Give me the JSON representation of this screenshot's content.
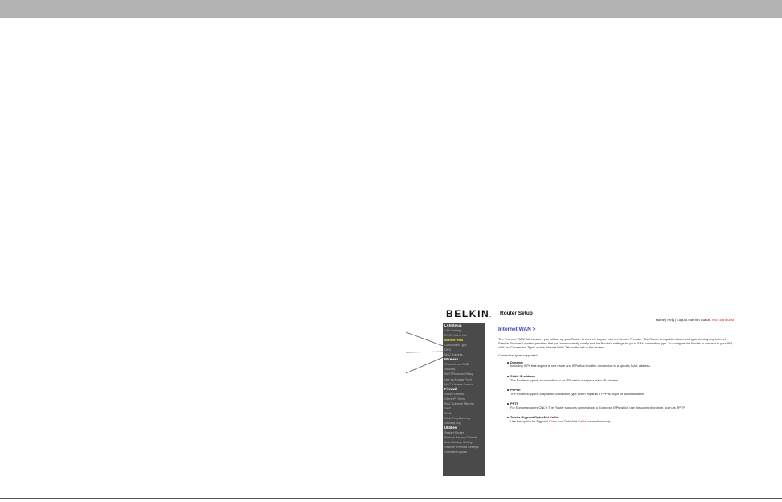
{
  "header": {
    "brand": "BELKIN",
    "title": "Router Setup",
    "links": {
      "home": "Home",
      "help": "Help",
      "logout": "Logout",
      "separator": "|"
    },
    "status_label": "Internet Status:",
    "status_value": "Not connected",
    "colors": {
      "status": "#d41a1a"
    }
  },
  "sidebar": {
    "items": [
      {
        "label": "LAN Setup",
        "type": "section"
      },
      {
        "label": "LAN Settings",
        "type": "item"
      },
      {
        "label": "DHCP Client List",
        "type": "item"
      },
      {
        "label": "Internet WAN",
        "type": "active"
      },
      {
        "label": "Connection Type",
        "type": "item"
      },
      {
        "label": "DNS",
        "type": "item"
      },
      {
        "label": "MAC Address",
        "type": "item"
      },
      {
        "label": "Wireless",
        "type": "section"
      },
      {
        "label": "Channel and SSID",
        "type": "item"
      },
      {
        "label": "Security",
        "type": "item"
      },
      {
        "label": "Wi-Fi Protected Setup",
        "type": "item"
      },
      {
        "label": "Use as Access Point",
        "type": "item"
      },
      {
        "label": "MAC Address Control",
        "type": "item"
      },
      {
        "label": "Firewall",
        "type": "section"
      },
      {
        "label": "Virtual Servers",
        "type": "item"
      },
      {
        "label": "Client IP Filters",
        "type": "item"
      },
      {
        "label": "MAC Address Filtering",
        "type": "item"
      },
      {
        "label": "DMZ",
        "type": "item"
      },
      {
        "label": "WAN",
        "type": "item"
      },
      {
        "label": "WAN Ping Blocking",
        "type": "item"
      },
      {
        "label": "Security Log",
        "type": "item"
      },
      {
        "label": "Utilities",
        "type": "section"
      },
      {
        "label": "Restart Router",
        "type": "item"
      },
      {
        "label": "Restore Factory Defaults",
        "type": "item"
      },
      {
        "label": "Save/Backup Settings",
        "type": "item"
      },
      {
        "label": "Restore Previous Settings",
        "type": "item"
      },
      {
        "label": "Firmware Update",
        "type": "item"
      }
    ],
    "colors": {
      "background": "#4a4a4a",
      "section": "#ffffff",
      "item": "#b9b9b9",
      "active": "#f2e21a"
    }
  },
  "main": {
    "title": "Internet WAN >",
    "intro": "The \"Internet WAN\" tab is where you will set up your Router to connect to your Internet Service Provider. The Router is capable of connecting to virtually any Internet Service Provider's system provided that you have correctly configured the Router's settings for your ISP's connection type. To configure the Router to connect to your ISP, click on \"Connection Type\" on the Internet WAN Tab on the left of the screen.",
    "supported_label": "Connection types supported:",
    "types": [
      {
        "name": "Dynamic",
        "desc": "Including ISPs that require a host name and ISPs that bind the connection to a specific MAC address."
      },
      {
        "name": "Static IP address",
        "desc": "The Router supports a connection to an ISP which assigns a static IP address"
      },
      {
        "name": "PPPoE",
        "desc": "The Router supports a dynamic connection type which requires a PPPoE login for authentication"
      },
      {
        "name": "PPTP",
        "desc": "For European users ONLY. The Router supports connections to European ISPs which use this connection type, such as PPTP."
      },
      {
        "name": "Telstra Bigpond/OptusNet Cable",
        "desc_pre": "Use this option for Bigpond",
        "desc_red1": "Cable",
        "desc_mid": "and OptusNet",
        "desc_red2": "Cable",
        "desc_post": "connections only."
      }
    ],
    "colors": {
      "title": "#3a3ab0",
      "highlight": "#d41a1a"
    }
  }
}
